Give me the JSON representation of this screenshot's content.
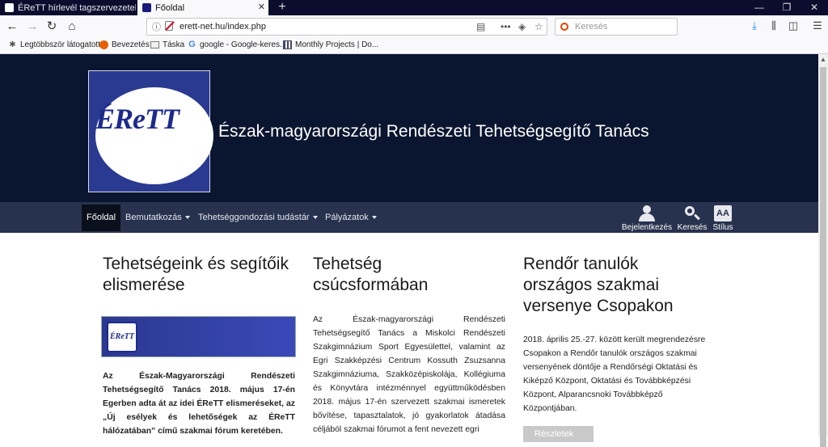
{
  "browser": {
    "tabs": [
      {
        "label": "ÉReTT hírlevél tagszervezeteknek",
        "active": false
      },
      {
        "label": "Főoldal",
        "active": true
      }
    ],
    "url": "erett-net.hu/index.php",
    "search_placeholder": "Keresés",
    "bookmarks": [
      {
        "label": "Legtöbbször látogatott",
        "icon": "gear-icon"
      },
      {
        "label": "Bevezetés",
        "icon": "firefox-icon"
      },
      {
        "label": "Táska",
        "icon": "folder-icon"
      },
      {
        "label": "google - Google-keres...",
        "icon": "google-icon"
      },
      {
        "label": "Monthly Projects | Do...",
        "icon": "grid-icon"
      }
    ]
  },
  "site": {
    "logo_text": "ÉReTT",
    "title": "Észak-magyarországi Rendészeti Tehetségsegítő Tanács"
  },
  "menu": {
    "items": [
      {
        "label": "Főoldal",
        "active": true,
        "dropdown": false
      },
      {
        "label": "Bemutatkozás",
        "active": false,
        "dropdown": true
      },
      {
        "label": "Tehetséggondozási tudástár",
        "active": false,
        "dropdown": true
      },
      {
        "label": "Pályázatok",
        "active": false,
        "dropdown": true
      }
    ],
    "tools": {
      "login": "Bejelentkezés",
      "search": "Keresés",
      "style": "Stílus",
      "style_glyph": "AA"
    }
  },
  "articles": [
    {
      "title": "Tehetségeink és segítőik elismerése",
      "banner_logo": "ÉReTT",
      "body": "Az Észak-Magyarországi Rendészeti Tehetségsegítő Tanács 2018. május 17-én Egerben adta át az idei ÉReTT elismeréseket, az „Új esélyek és lehetőségek az ÉReTT hálózatában” című szakmai fórum keretében."
    },
    {
      "title": "Tehetség csúcsformában",
      "body": "Az Észak-magyarországi Rendészeti Tehetségsegítő Tanács a Miskolci Rendészeti Szakgimnázium Sport Egyesülettel, valamint az Egri Szakképzési Centrum Kossuth Zsuzsanna Szakgimnáziuma, Szakközépiskolája, Kollégiuma és Könyvtára intézménnyel együttműködésben 2018. május 17-én szervezett szakmai ismeretek bővítése, tapasztalatok, jó gyakorlatok átadása céljából szakmai fórumot a fent nevezett egri"
    },
    {
      "title": "Rendőr tanulók országos szakmai versenye Csopakon",
      "body": "2018. április 25.-27. között került megrendezésre Csopakon a Rendőr tanulók országos szakmai versenyének döntője a Rendőrségi Oktatási és Kiképző Központ, Oktatási és Továbbképzési Központ, Alparancsnoki Továbbképző Központjában.",
      "more_label": "Részletek"
    }
  ]
}
